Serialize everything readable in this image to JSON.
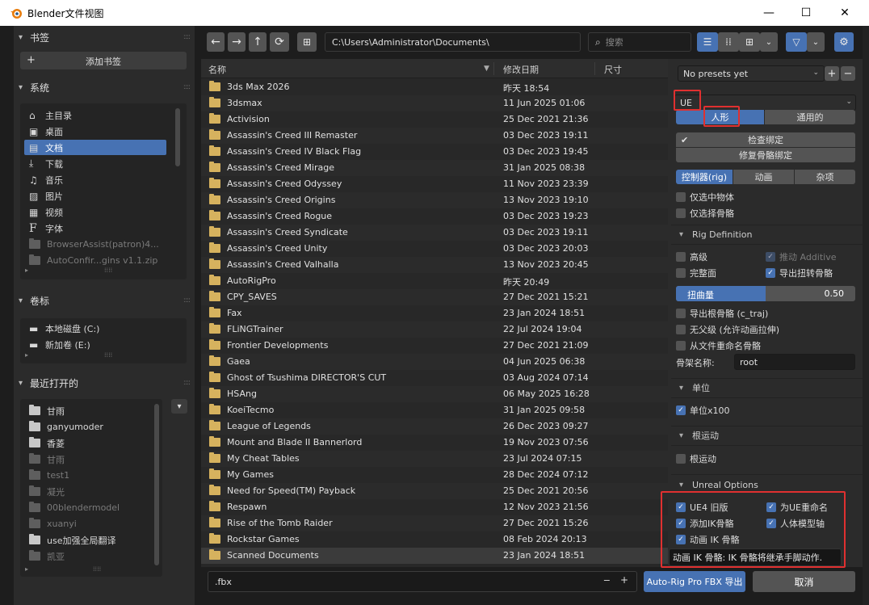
{
  "window": {
    "title": "Blender文件视图",
    "minimize": "—",
    "maximize": "☐",
    "close": "✕"
  },
  "sidebar": {
    "bookmarks": {
      "title": "书签",
      "add_label": "添加书签"
    },
    "system": {
      "title": "系统",
      "items": [
        {
          "label": "主目录",
          "icon": "home-icon"
        },
        {
          "label": "桌面",
          "icon": "desktop-icon"
        },
        {
          "label": "文档",
          "icon": "documents-icon",
          "selected": true
        },
        {
          "label": "下载",
          "icon": "download-icon"
        },
        {
          "label": "音乐",
          "icon": "music-icon"
        },
        {
          "label": "图片",
          "icon": "image-icon"
        },
        {
          "label": "视频",
          "icon": "video-icon"
        },
        {
          "label": "字体",
          "icon": "font-icon"
        },
        {
          "label": "BrowserAssist(patron)4...",
          "icon": "folder-icon",
          "dim": true
        },
        {
          "label": "AutoConfir...gins v1.1.zip",
          "icon": "folder-icon",
          "dim": true
        }
      ]
    },
    "volumes": {
      "title": "卷标",
      "items": [
        {
          "label": "本地磁盘 (C:)"
        },
        {
          "label": "新加卷 (E:)"
        }
      ]
    },
    "recent": {
      "title": "最近打开的",
      "items": [
        {
          "label": "甘雨",
          "dim": false
        },
        {
          "label": "ganyumoder",
          "dim": false
        },
        {
          "label": "香菱",
          "dim": false
        },
        {
          "label": "甘雨",
          "dim": true
        },
        {
          "label": "test1",
          "dim": true
        },
        {
          "label": "凝光",
          "dim": true
        },
        {
          "label": "00blendermodel",
          "dim": true
        },
        {
          "label": "xuanyi",
          "dim": true
        },
        {
          "label": "use加强全局翻译",
          "dim": false
        },
        {
          "label": "凯亚",
          "dim": true
        }
      ]
    }
  },
  "toolbar": {
    "back": "←",
    "forward": "→",
    "parent": "↑",
    "refresh": "⟳",
    "path": "C:\\Users\\Administrator\\Documents\\",
    "search_placeholder": "搜索"
  },
  "filelist": {
    "col_name": "名称",
    "col_date": "修改日期",
    "col_size": "尺寸",
    "rows": [
      {
        "name": "3ds Max 2026",
        "date": "昨天 18:54"
      },
      {
        "name": "3dsmax",
        "date": "11 Jun 2025 01:06"
      },
      {
        "name": "Activision",
        "date": "25 Dec 2021 21:36"
      },
      {
        "name": "Assassin's Creed III Remaster",
        "date": "03 Dec 2023 19:11"
      },
      {
        "name": "Assassin's Creed IV Black Flag",
        "date": "03 Dec 2023 19:45"
      },
      {
        "name": "Assassin's Creed Mirage",
        "date": "31 Jan 2025 08:38"
      },
      {
        "name": "Assassin's Creed Odyssey",
        "date": "11 Nov 2023 23:39"
      },
      {
        "name": "Assassin's Creed Origins",
        "date": "13 Nov 2023 19:10"
      },
      {
        "name": "Assassin's Creed Rogue",
        "date": "03 Dec 2023 19:23"
      },
      {
        "name": "Assassin's Creed Syndicate",
        "date": "03 Dec 2023 19:11"
      },
      {
        "name": "Assassin's Creed Unity",
        "date": "03 Dec 2023 20:03"
      },
      {
        "name": "Assassin's Creed Valhalla",
        "date": "13 Nov 2023 20:45"
      },
      {
        "name": "AutoRigPro",
        "date": "昨天 20:49"
      },
      {
        "name": "CPY_SAVES",
        "date": "27 Dec 2021 15:21"
      },
      {
        "name": "Fax",
        "date": "23 Jan 2024 18:51"
      },
      {
        "name": "FLiNGTrainer",
        "date": "22 Jul 2024 19:04"
      },
      {
        "name": "Frontier Developments",
        "date": "27 Dec 2021 21:09"
      },
      {
        "name": "Gaea",
        "date": "04 Jun 2025 06:38"
      },
      {
        "name": "Ghost of Tsushima DIRECTOR'S CUT",
        "date": "03 Aug 2024 07:14"
      },
      {
        "name": "HSAng",
        "date": "06 May 2025 16:28"
      },
      {
        "name": "KoeiTecmo",
        "date": "31 Jan 2025 09:58"
      },
      {
        "name": "League of Legends",
        "date": "26 Dec 2023 09:27"
      },
      {
        "name": "Mount and Blade II Bannerlord",
        "date": "19 Nov 2023 07:56"
      },
      {
        "name": "My Cheat Tables",
        "date": "23 Jul 2024 07:15"
      },
      {
        "name": "My Games",
        "date": "28 Dec 2024 07:12"
      },
      {
        "name": "Need for Speed(TM) Payback",
        "date": "25 Dec 2021 20:56"
      },
      {
        "name": "Respawn",
        "date": "12 Nov 2023 21:56"
      },
      {
        "name": "Rise of the Tomb Raider",
        "date": "27 Dec 2021 15:26"
      },
      {
        "name": "Rockstar Games",
        "date": "08 Feb 2024 20:13"
      },
      {
        "name": "Scanned Documents",
        "date": "23 Jan 2024 18:51"
      }
    ]
  },
  "bottom": {
    "filter_value": ".fbx",
    "export_label": "Auto-Rig Pro FBX 导出",
    "cancel_label": "取消"
  },
  "options": {
    "presets_label": "No presets yet",
    "engine": "UE",
    "tabs1": [
      "人形",
      "通用的"
    ],
    "check_bind": "检查绑定",
    "fix_bind": "修复骨骼绑定",
    "tabs2": [
      "控制器(rig)",
      "动画",
      "杂项"
    ],
    "selected_only": "仅选中物体",
    "selected_bones": "仅选择骨骼",
    "rig_def_title": "Rig Definition",
    "advanced": "高级",
    "push_additive": "推动 Additive",
    "full_face": "完整面",
    "export_twist": "导出扭转骨骼",
    "twist_label": "扭曲量",
    "twist_value": "0.50",
    "export_root": "导出根骨骼 (c_traj)",
    "no_parent": "无父级 (允许动画拉伸)",
    "rename_from_file": "从文件重命名骨骼",
    "skeleton_name_label": "骨架名称:",
    "skeleton_name": "root",
    "units_title": "单位",
    "units_x100": "单位x100",
    "root_motion_title": "根运动",
    "root_motion": "根运动",
    "unreal_title": "Unreal Options",
    "ue4_legacy": "UE4 旧版",
    "rename_ue": "为UE重命名",
    "add_ik": "添加IK骨骼",
    "humanoid_axis": "人体模型轴",
    "anim_ik": "动画 IK 骨骼",
    "tooltip": "动画 IK 骨骼: IK 骨骼将继承手脚动作."
  },
  "colors": {
    "accent": "#4772b3",
    "highlight": "#e03030",
    "folder": "#d6b25e"
  }
}
